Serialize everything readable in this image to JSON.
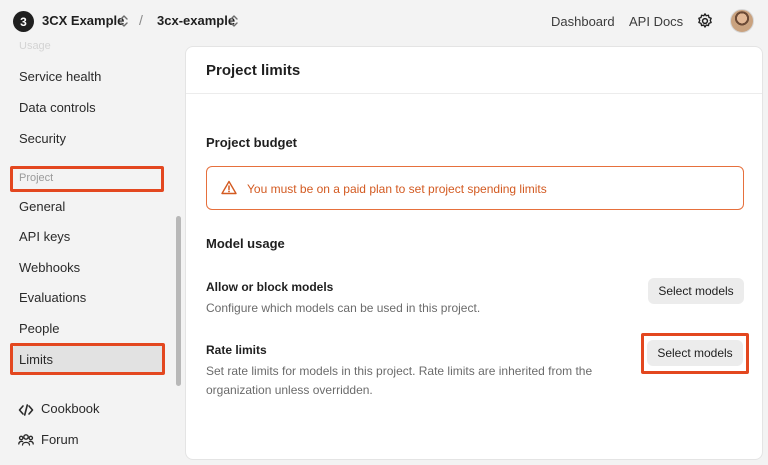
{
  "topbar": {
    "org_badge": "3",
    "org_name": "3CX Example",
    "separator": "/",
    "project_name": "3cx-example",
    "nav": [
      "Dashboard",
      "API Docs"
    ]
  },
  "sidebar": {
    "faded_section": "Usage",
    "items_top": [
      "Service health",
      "Data controls",
      "Security"
    ],
    "section_label": "Project",
    "items_project": [
      "General",
      "API keys",
      "Webhooks",
      "Evaluations",
      "People",
      "Limits"
    ],
    "active_item": "Limits",
    "footer": [
      {
        "label": "Cookbook",
        "icon": "code-icon"
      },
      {
        "label": "Forum",
        "icon": "people-icon"
      }
    ]
  },
  "main": {
    "title": "Project limits",
    "budget": {
      "title": "Project budget",
      "alert": "You must be on a paid plan to set project spending limits"
    },
    "model_usage": {
      "title": "Model usage",
      "rows": [
        {
          "title": "Allow or block models",
          "description": "Configure which models can be used in this project.",
          "button": "Select models"
        },
        {
          "title": "Rate limits",
          "description": "Set rate limits for models in this project. Rate limits are inherited from the organization unless overridden.",
          "button": "Select models"
        }
      ]
    }
  },
  "colors": {
    "highlight": "#e3471f",
    "warning": "#d35a21"
  }
}
